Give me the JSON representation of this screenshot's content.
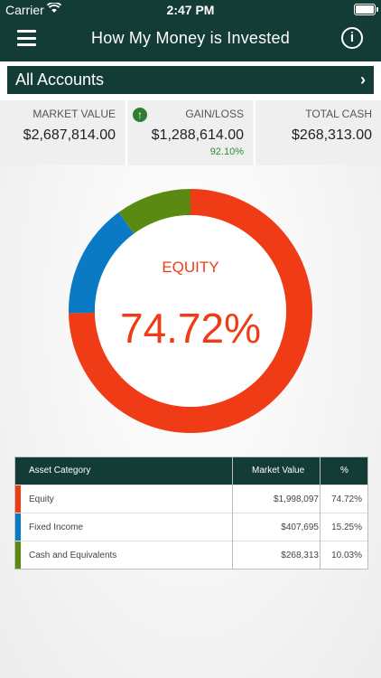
{
  "status_bar": {
    "carrier": "Carrier",
    "time": "2:47 PM"
  },
  "header": {
    "title": "How My Money is Invested"
  },
  "account_selector": {
    "label": "All Accounts"
  },
  "stats": {
    "market_value": {
      "title": "MARKET VALUE",
      "value": "$2,687,814.00"
    },
    "gain_loss": {
      "title": "GAIN/LOSS",
      "value": "$1,288,614.00",
      "percent": "92.10%"
    },
    "total_cash": {
      "title": "TOTAL CASH",
      "value": "$268,313.00"
    }
  },
  "donut": {
    "center_label": "EQUITY",
    "center_percent": "74.72%",
    "segments": [
      {
        "name": "Equity",
        "value": 74.72,
        "color": "#f03c16"
      },
      {
        "name": "Fixed Income",
        "value": 15.25,
        "color": "#0b7ac4"
      },
      {
        "name": "Cash and Equivalents",
        "value": 10.03,
        "color": "#5b8a13"
      }
    ]
  },
  "table": {
    "headers": {
      "category": "Asset Category",
      "market_value": "Market Value",
      "percent": "%"
    },
    "rows": [
      {
        "category": "Equity",
        "market_value": "$1,998,097",
        "percent": "74.72%",
        "color": "#f03c16"
      },
      {
        "category": "Fixed Income",
        "market_value": "$407,695",
        "percent": "15.25%",
        "color": "#0b7ac4"
      },
      {
        "category": "Cash and Equivalents",
        "market_value": "$268,313",
        "percent": "10.03%",
        "color": "#5b8a13"
      }
    ]
  },
  "colors": {
    "header_bg": "#133c36",
    "gain_green": "#2e8b3c"
  }
}
